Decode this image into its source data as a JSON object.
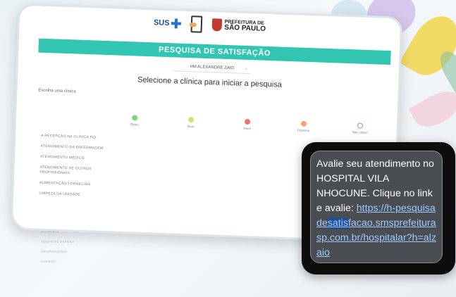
{
  "tablet": {
    "logos": {
      "sus": "SUS",
      "prefeitura_l1": "PREFEITURA DE",
      "prefeitura_l2": "SÃO PAULO"
    },
    "banner": "PESQUISA DE SATISFAÇÃO",
    "hospital_select": "HM ALEXANDRE ZAIO",
    "heading": "Selecione a clínica para iniciar a pesquisa",
    "clinic_label": "Escolha uma clínica",
    "ratings": [
      {
        "label": "Ótimo",
        "color": "#7fd47f"
      },
      {
        "label": "Bom",
        "color": "#cde56a"
      },
      {
        "label": "Ruim",
        "color": "#f07070"
      },
      {
        "label": "Péssimo",
        "color": "#f5a27a"
      },
      {
        "label": "Não utilizei",
        "color": "#f07070"
      }
    ],
    "categories": [
      "A RECEPÇÃO NA CLÍNICA FOI",
      "ATENDIMENTO DA ENFERMAGEM",
      "ATENDIMENTO MÉDICO",
      "ATENDIMENTO DE OUTROS PROFISSIONAIS",
      "ALIMENTAÇÃO FORNECIDA",
      "LIMPEZA DA UNIDADE"
    ],
    "overflow": [
      "ROUPARIA",
      "TEMPO DE ESPERA",
      "INFORMAÇÕES",
      "OUTROS"
    ]
  },
  "sms": {
    "text": "Avalie seu atendimento no HOSPITAL VILA NHOCUNE. Clique no link e avalie: ",
    "link_a": "https://h-pesquisade",
    "link_hl": "satis",
    "link_b": "facao.smsprefeiturasp.com.br/hospitalar?h=alzaio"
  }
}
